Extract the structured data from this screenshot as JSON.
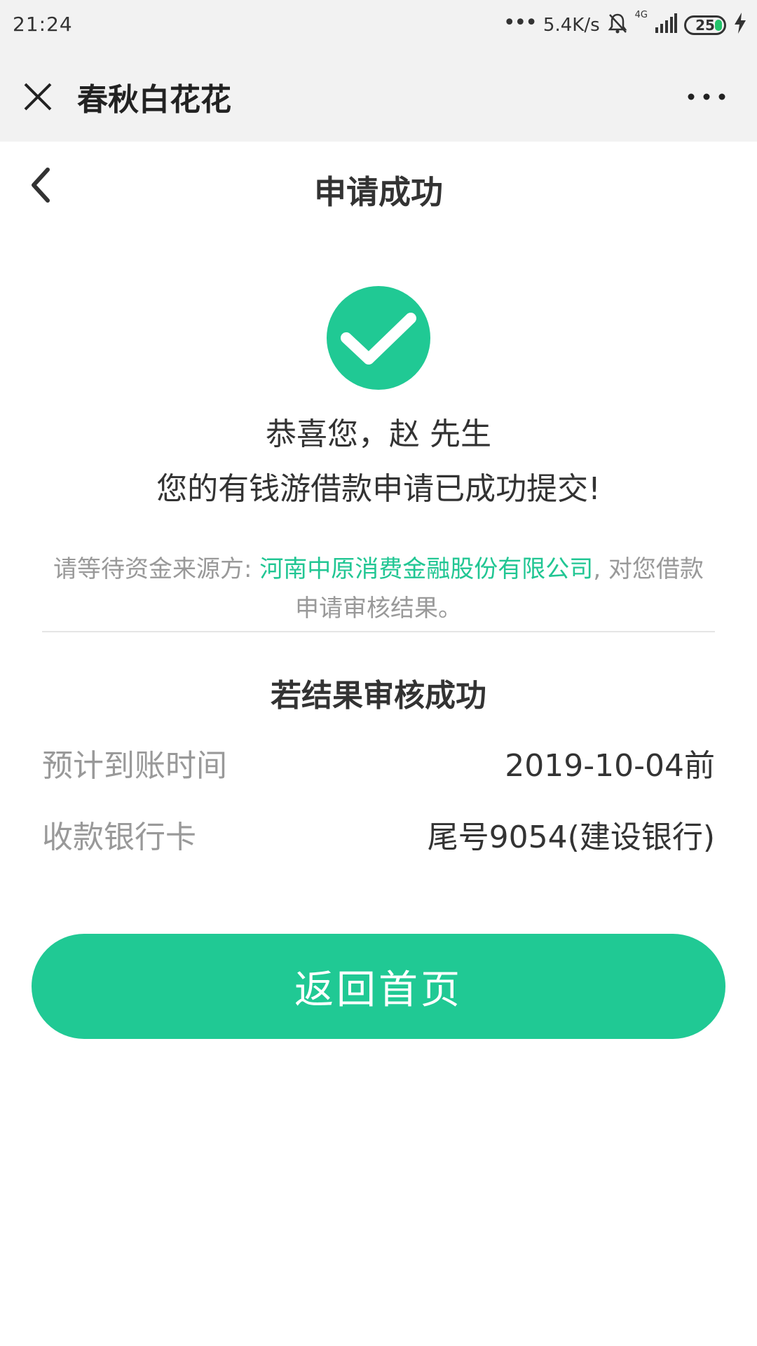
{
  "status_bar": {
    "time": "21:24",
    "network_speed": "5.4K/s",
    "network_type": "4G",
    "battery": "25",
    "icons": [
      "signal-dots-icon",
      "silent-bell-icon",
      "cell-signal-icon",
      "battery-icon",
      "charging-icon"
    ]
  },
  "title_bar": {
    "title": "春秋白花花",
    "close_icon": "close-icon",
    "more_icon": "more-icon"
  },
  "header": {
    "title": "申请成功",
    "back_icon": "chevron-left-icon"
  },
  "success": {
    "icon": "check-circle-icon",
    "greeting": "恭喜您，赵 先生",
    "message": "您的有钱游借款申请已成功提交!"
  },
  "notice": {
    "prefix": "请等待资金来源方: ",
    "lender": "河南中原消费金融股份有限公司",
    "suffix": ", 对您借款申请审核结果。"
  },
  "result": {
    "title": "若结果审核成功",
    "rows": [
      {
        "label": "预计到账时间",
        "value": "2019-10-04前"
      },
      {
        "label": "收款银行卡",
        "value": "尾号9054(建设银行)"
      }
    ]
  },
  "button": {
    "label": "返回首页"
  },
  "colors": {
    "accent": "#20c994",
    "lender_text": "#21c693",
    "bar_bg": "#f2f2f2"
  }
}
